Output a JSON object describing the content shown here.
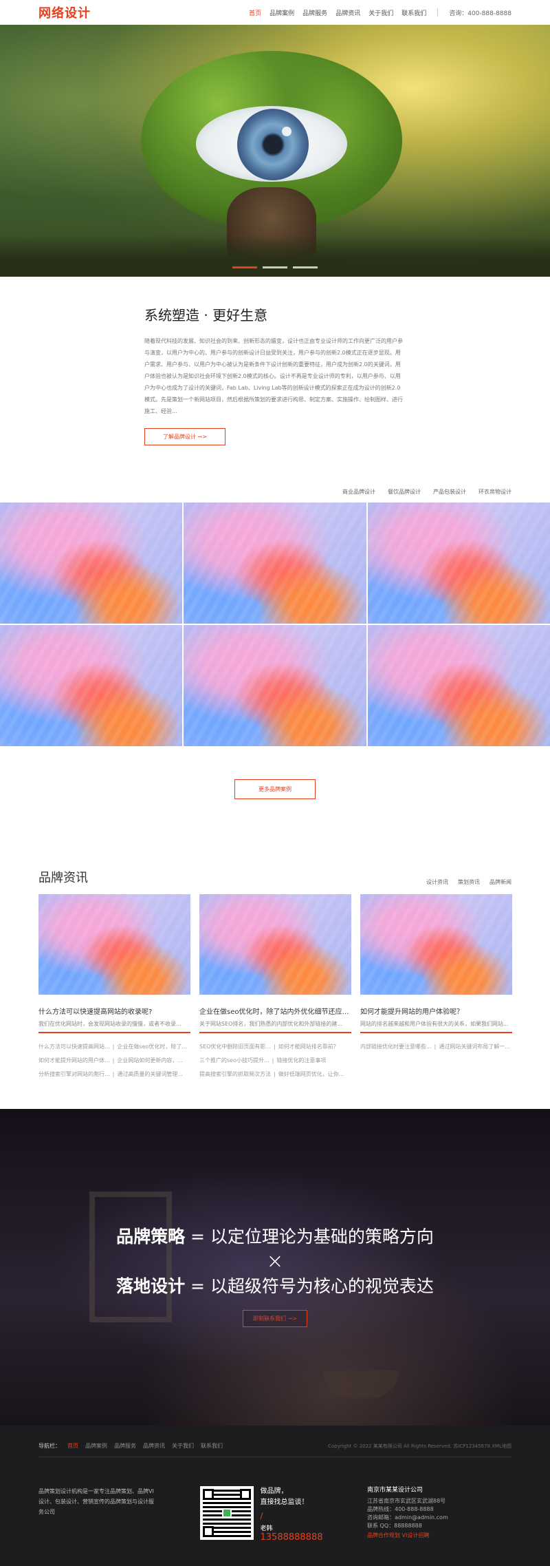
{
  "header": {
    "logo": "网络设计",
    "nav": [
      "首页",
      "品牌案例",
      "品牌服务",
      "品牌资讯",
      "关于我们",
      "联系我们"
    ],
    "phone": "咨询：400-888-8888"
  },
  "hero": {
    "slide_count": 3,
    "active_slide": 1
  },
  "about": {
    "title": "系统塑造 · 更好生意",
    "body": "随着现代科技的发展、知识社会的到来、创新形态的嬗变，设计也正由专业设计师的工作向更广泛的用户参与演变，以用户为中心的、用户参与的创新设计日益受到关注，用户参与的创新2.0模式正在逐步显现。用户需求、用户参与、以用户为中心被认为是新条件下设计创新的重要特征，用户成为创新2.0的关键词，用户体验也被认为是知识社会环境下创新2.0模式的核心。设计不再是专业设计师的专利，以用户参与、以用户为中心也成为了设计的关键词，Fab Lab、Living Lab等的创新设计模式的探索正在成为设计的创新2.0模式。先是策划一个新网站项目，然后根据所策划的要求进行构思、制定方案、实施操作、绘制图样、进行施工、经验...",
    "button": "了解品牌设计 ⊸>"
  },
  "case_tabs": [
    "商业品牌设计",
    "餐饮品牌设计",
    "产品包装设计",
    "环衣帛物设计"
  ],
  "gallery_count": 6,
  "more_button": "更多品牌案例",
  "news": {
    "title": "品牌资讯",
    "tabs": [
      "设计资讯",
      "策划资讯",
      "品牌新闻"
    ],
    "cards": [
      {
        "title": "什么方法可以快速提高网站的收录呢?",
        "summary": "我们在优化网站时，会发现网站收录的慢慢，或者不收录...",
        "links": [
          [
            "什么方法可以快速提高网站...",
            "企业在做seo优化时，除了..."
          ],
          [
            "如何才能提升网站的用户体...",
            "企业网站如何更新内容，..."
          ],
          [
            "分析搜索引擎对网站的爬行...",
            "通过高质量的关键词管理..."
          ]
        ]
      },
      {
        "title": "企业在做seo优化时，除了站内外优化细节还应注...",
        "summary": "关于网站SEO排名，我们熟悉的内部优化和外部链接的建...",
        "links": [
          [
            "SEO优化中删除旧页面有影...",
            "如何才能网站排名靠前？"
          ],
          [
            "三个推广的seo小技巧提升...",
            "链接优化的注意事项"
          ],
          [
            "提高搜索引擎的抓取频次方法",
            "做好低端网页优化，让你..."
          ]
        ]
      },
      {
        "title": "如何才能提升网站的用户体验呢？",
        "summary": "网站的排名越来越和用户体验有很大的关系，如果我们网站...",
        "links": [
          [
            "内部链接优化时要注意哪些...",
            "通过网站关键词布局了解一..."
          ]
        ]
      }
    ]
  },
  "band": {
    "line1_bold": "品牌策略",
    "line1_rest": " = 以定位理论为基础的策略方向",
    "cross": "×",
    "line2_bold": "落地设计",
    "line2_rest": " = 以超级符号为核心的视觉表达",
    "button": "即刻联系我们 ⊸>"
  },
  "footer": {
    "nav_label": "导航栏：",
    "nav": [
      "首页",
      "品牌案例",
      "品牌服务",
      "品牌资讯",
      "关于我们",
      "联系我们"
    ],
    "copyright": "Copyright © 2022 某某有限公司 All Rights Reserved. 苏ICP12345678 XML地图",
    "intro": "品牌策划设计机构是一家专注品牌策划、品牌VI设计、包装设计、营销宣传的品牌策划与设计服务公司",
    "qr_line1": "做品牌，",
    "qr_line2": "直接找总监谈！",
    "qr_slash": "/",
    "qr_person": "老韩",
    "qr_tel": "13588888888",
    "company": "南京市某某设计公司",
    "address": "江苏省南京市玄武区玄武湖88号",
    "hotline": "品牌热线：400-888-8888",
    "email": "咨询邮箱：admin@admin.com",
    "qq": "联系 QQ：88888888",
    "tags": "品牌合作规划   VI设计招聘"
  },
  "colors": {
    "accent": "#e8401c",
    "footer_bg": "#1d1d1f"
  }
}
